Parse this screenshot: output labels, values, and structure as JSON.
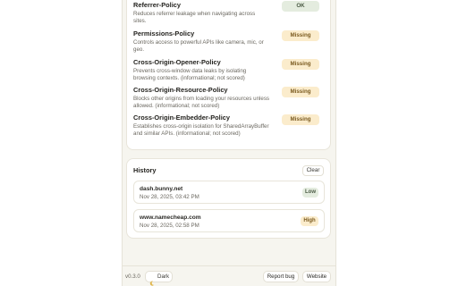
{
  "policies": [
    {
      "title": "Referrer-Policy",
      "description": "Reduces referrer leakage when navigating across sites.",
      "status": "OK"
    },
    {
      "title": "Permissions-Policy",
      "description": "Controls access to powerful APIs like camera, mic, or geo.",
      "status": "Missing"
    },
    {
      "title": "Cross-Origin-Opener-Policy",
      "description": "Prevents cross-window data leaks by isolating browsing contexts. (informational; not scored)",
      "status": "Missing"
    },
    {
      "title": "Cross-Origin-Resource-Policy",
      "description": "Blocks other origins from loading your resources unless allowed. (informational; not scored)",
      "status": "Missing"
    },
    {
      "title": "Cross-Origin-Embedder-Policy",
      "description": "Establishes cross-origin isolation for SharedArrayBuffer and similar APIs. (informational; not scored)",
      "status": "Missing"
    }
  ],
  "history": {
    "title": "History",
    "clear_label": "Clear",
    "items": [
      {
        "host": "dash.bunny.net",
        "date": "Nov 28, 2025, 03:42 PM",
        "grade": "Low"
      },
      {
        "host": "www.namecheap.com",
        "date": "Nov 28, 2025, 02:58 PM",
        "grade": "High"
      }
    ]
  },
  "footer": {
    "version": "v0.3.0",
    "theme_label": "Dark",
    "theme_icon": "moon-icon",
    "report_label": "Report bug",
    "website_label": "Website"
  },
  "colors": {
    "ok": "#e4ecdf",
    "missing": "#fbeccc",
    "panel": "#f6f5ef"
  }
}
